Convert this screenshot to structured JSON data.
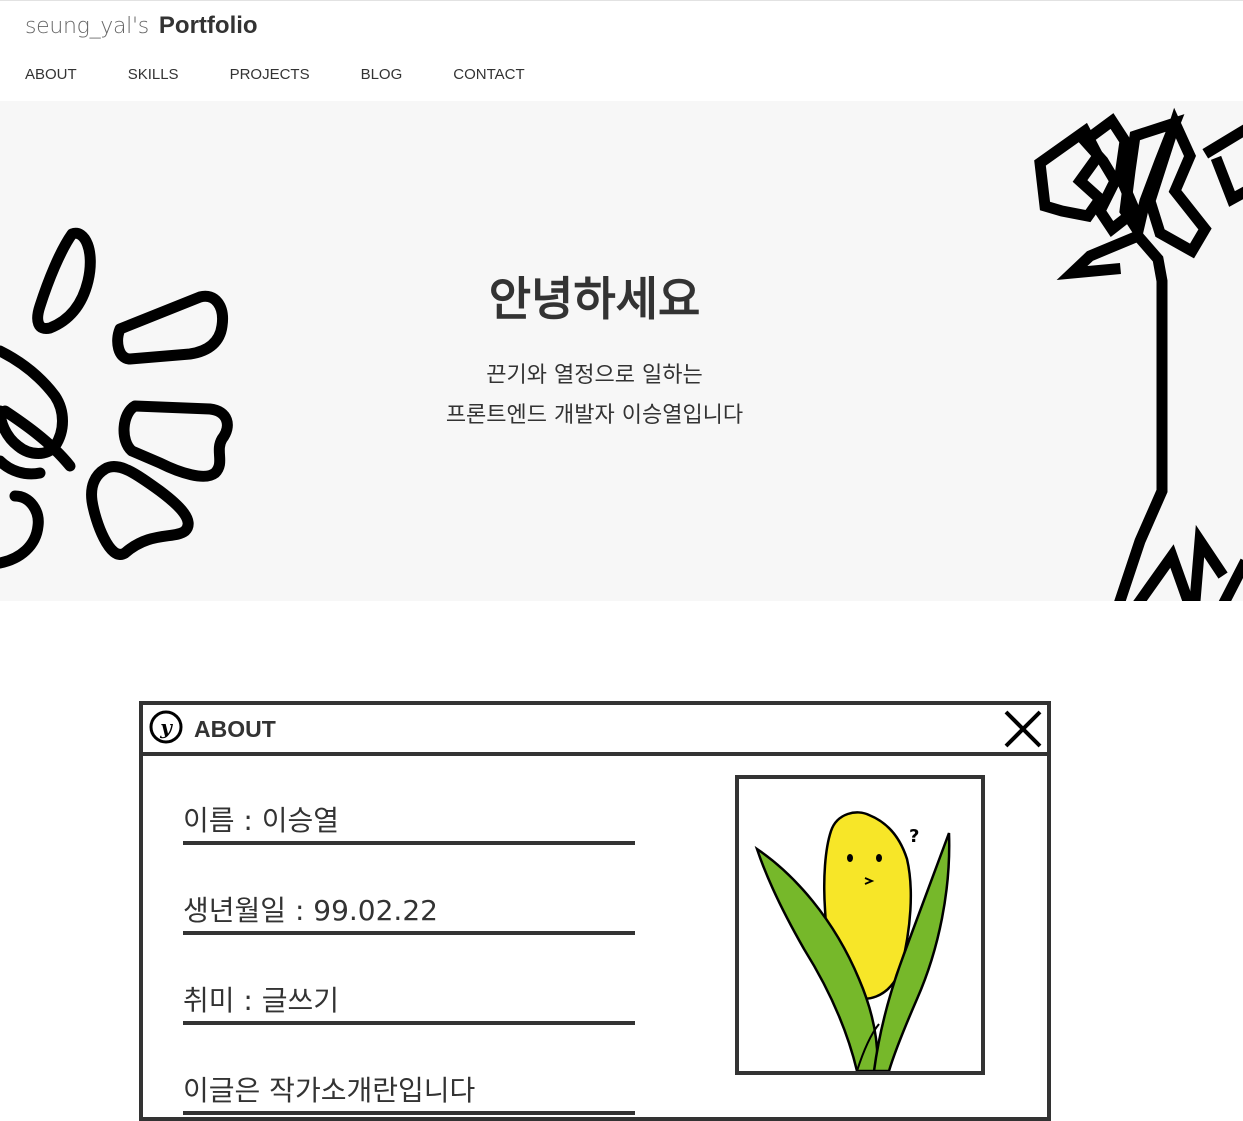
{
  "header": {
    "logo_light": "seung_yal's",
    "logo_bold": "Portfolio"
  },
  "nav": {
    "items": [
      "ABOUT",
      "SKILLS",
      "PROJECTS",
      "BLOG",
      "CONTACT"
    ]
  },
  "hero": {
    "title": "안녕하세요",
    "subtitle_line1": "끈기와 열정으로 일하는",
    "subtitle_line2": "프론트엔드 개발자 이승열입니다"
  },
  "about": {
    "window_title": "ABOUT",
    "logo_glyph": "y",
    "rows": [
      "이름 : 이승열",
      "생년월일 : 99.02.22",
      "취미 : 글쓰기",
      "이글은 작가소개란입니다"
    ]
  },
  "colors": {
    "text": "#333333",
    "hero_bg": "#f7f7f7",
    "corn_yellow": "#f7e628",
    "leaf_green": "#76b82a"
  }
}
